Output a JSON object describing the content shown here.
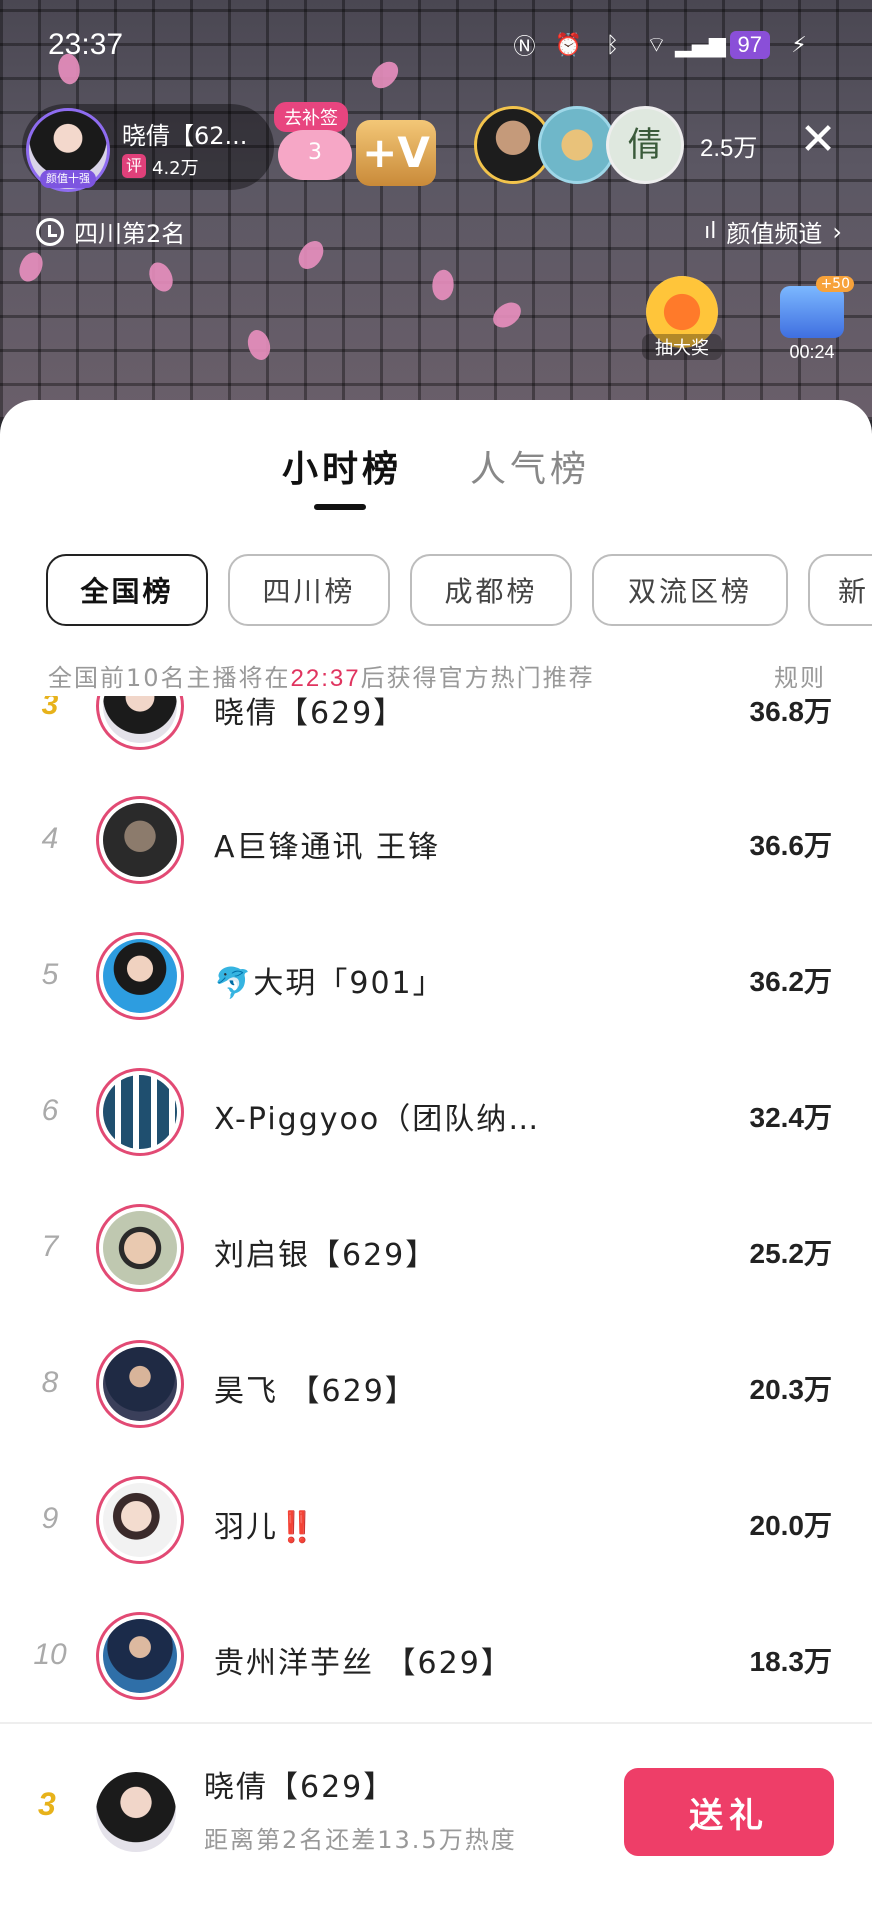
{
  "status_bar": {
    "time": "23:37",
    "battery": "97"
  },
  "anchor": {
    "name": "晓倩【62...",
    "tag": "颜值十强",
    "badge": "评",
    "fans": "4.2万"
  },
  "bucha": {
    "tag": "去补签",
    "count": "3",
    "v_label": "+V"
  },
  "viewers": {
    "count": "2.5万",
    "third_avatar_char": "倩"
  },
  "location": {
    "rank_text": "四川第2名"
  },
  "channel": {
    "label": "颜值频道"
  },
  "widgets": {
    "lottery_label": "抽大奖",
    "timer_label": "00:24",
    "timer_plus": "+50"
  },
  "ranking": {
    "tabs": [
      {
        "label": "小时榜",
        "active": true
      },
      {
        "label": "人气榜",
        "active": false
      }
    ],
    "chips": [
      {
        "label": "全国榜",
        "active": true
      },
      {
        "label": "四川榜",
        "active": false
      },
      {
        "label": "成都榜",
        "active": false
      },
      {
        "label": "双流区榜",
        "active": false
      },
      {
        "label": "新",
        "active": false
      }
    ],
    "notice_prefix": "全国前10名主播将在",
    "notice_time": "22:37",
    "notice_suffix": "后获得官方热门推荐",
    "rules_label": "规则",
    "rows": [
      {
        "rank": "3",
        "name": "晓倩【629】",
        "score": "36.8万",
        "gold": true
      },
      {
        "rank": "4",
        "name": "A巨锋通讯 王锋",
        "score": "36.6万",
        "gold": false
      },
      {
        "rank": "5",
        "name": "🐬大玥「901」",
        "score": "36.2万",
        "gold": false
      },
      {
        "rank": "6",
        "name": "X-Piggyoo（团队纳…",
        "score": "32.4万",
        "gold": false
      },
      {
        "rank": "7",
        "name": "刘启银【629】",
        "score": "25.2万",
        "gold": false
      },
      {
        "rank": "8",
        "name": "昊飞 【629】",
        "score": "20.3万",
        "gold": false
      },
      {
        "rank": "9",
        "name": "羽儿‼️",
        "score": "20.0万",
        "gold": false
      },
      {
        "rank": "10",
        "name": "贵州洋芋丝 【629】",
        "score": "18.3万",
        "gold": false
      }
    ]
  },
  "self": {
    "rank": "3",
    "name": "晓倩【629】",
    "sub": "距离第2名还差13.5万热度",
    "gift_button": "送礼"
  },
  "colors": {
    "accent": "#ee3e68",
    "gold_rank": "#e7b21a",
    "highlight_time": "#e0345f"
  }
}
